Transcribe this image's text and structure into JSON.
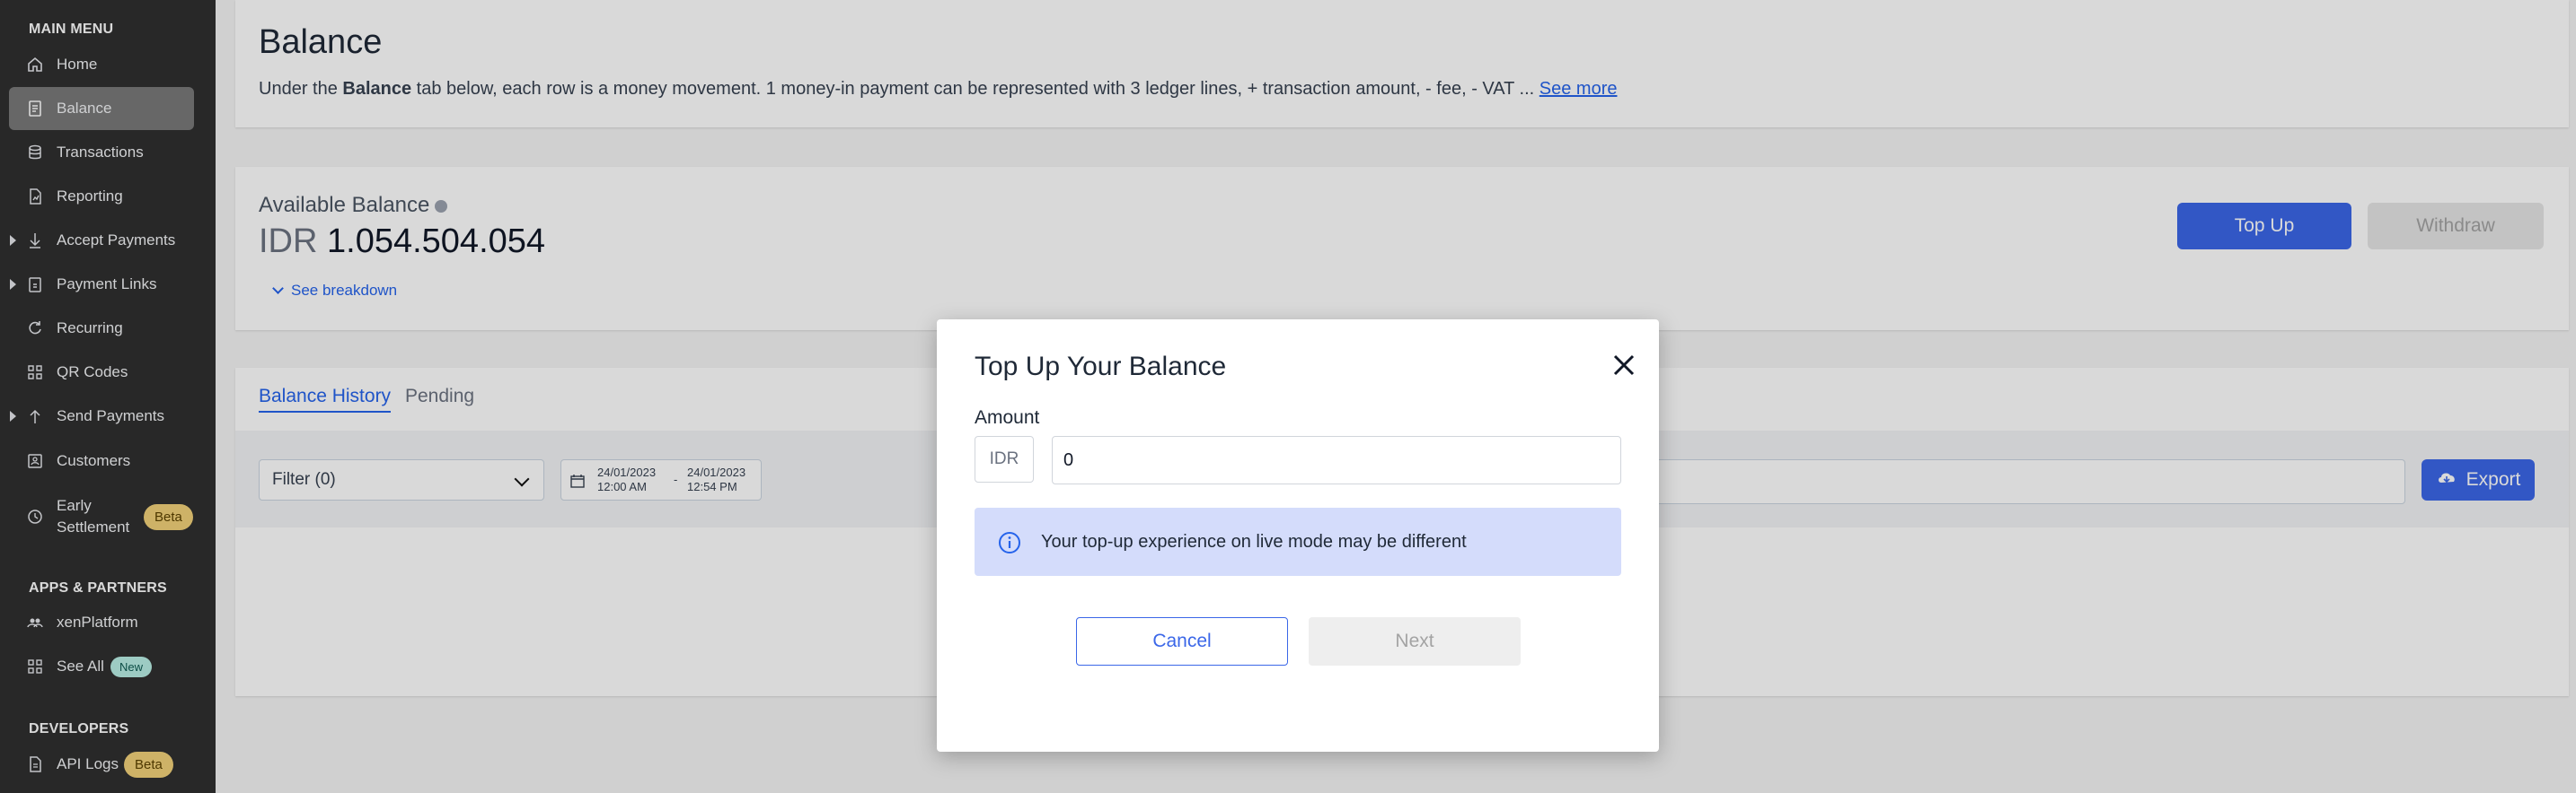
{
  "sidebar": {
    "main_menu_title": "MAIN MENU",
    "items": [
      {
        "label": "Home"
      },
      {
        "label": "Balance"
      },
      {
        "label": "Transactions"
      },
      {
        "label": "Reporting"
      },
      {
        "label": "Accept Payments"
      },
      {
        "label": "Payment Links"
      },
      {
        "label": "Recurring"
      },
      {
        "label": "QR Codes"
      },
      {
        "label": "Send Payments"
      },
      {
        "label": "Customers"
      },
      {
        "label_line1": "Early",
        "label_line2": "Settlement",
        "badge": "Beta"
      }
    ],
    "apps_title": "APPS & PARTNERS",
    "apps_items": [
      {
        "label": "xenPlatform"
      },
      {
        "label": "See All",
        "badge": "New"
      }
    ],
    "dev_title": "DEVELOPERS",
    "dev_items": [
      {
        "label": "API Logs",
        "badge": "Beta"
      }
    ]
  },
  "page": {
    "title": "Balance",
    "desc_prefix": "Under the ",
    "desc_bold": "Balance",
    "desc_suffix": " tab below, each row is a money movement. 1 money-in payment can be represented with 3 ledger lines, + transaction amount, - fee, - VAT ...",
    "desc_link": "See more"
  },
  "balance": {
    "label": "Available Balance",
    "currency": "IDR",
    "amount": "1.054.504.054",
    "see_breakdown": "See breakdown",
    "top_up": "Top Up",
    "withdraw": "Withdraw"
  },
  "tabs": [
    {
      "label": "Balance History"
    },
    {
      "label": "Pending"
    }
  ],
  "filters": {
    "filter_label": "Filter (0)",
    "date_from": "24/01/2023",
    "time_from": "12:00 AM",
    "date_to": "24/01/2023",
    "time_to": "12:54 PM",
    "separator": "-",
    "export": "Export"
  },
  "modal": {
    "title": "Top Up Your Balance",
    "amount_label": "Amount",
    "currency": "IDR",
    "amount_value": "0",
    "notice": "Your top-up experience on live mode may be different",
    "cancel": "Cancel",
    "next": "Next"
  },
  "colors": {
    "primary": "#3b67e8",
    "sidebar_bg": "#2f2f2f",
    "notice_bg": "#d4dcfb",
    "beta_badge": "#f2d27a",
    "new_badge": "#b9efe5"
  }
}
